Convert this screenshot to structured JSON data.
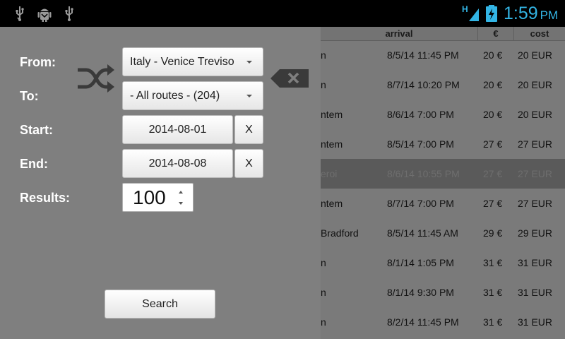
{
  "status_bar": {
    "icons": [
      "usb-icon",
      "android-debug-icon",
      "usb-icon",
      "signal-hspa-icon",
      "battery-charging-icon"
    ],
    "network_type": "H",
    "time": "1:59",
    "ampm": "PM",
    "accent_color": "#33b5e5"
  },
  "filters": {
    "from_label": "From:",
    "from_value": "Italy - Venice Treviso",
    "to_label": "To:",
    "to_value": "- All routes - (204)",
    "start_label": "Start:",
    "start_value": "2014-08-01",
    "end_label": "End:",
    "end_value": "2014-08-08",
    "clear_label": "X",
    "results_label": "Results:",
    "results_value": "100",
    "search_label": "Search",
    "swap_icon": "shuffle-icon",
    "clear_icon": "backspace-clear-icon"
  },
  "table": {
    "headers": [
      "arrival",
      "€",
      "cost"
    ],
    "rows": [
      {
        "name": "n",
        "arrival": "8/5/14 11:45 PM",
        "eur": "20 €",
        "cost": "20 EUR"
      },
      {
        "name": "n",
        "arrival": "8/7/14 10:20 PM",
        "eur": "20 €",
        "cost": "20 EUR"
      },
      {
        "name": "ntem",
        "arrival": "8/6/14 7:00 PM",
        "eur": "20 €",
        "cost": "20 EUR"
      },
      {
        "name": "ntem",
        "arrival": "8/5/14 7:00 PM",
        "eur": "27 €",
        "cost": "27 EUR"
      },
      {
        "name": "eroi",
        "arrival": "8/6/14 10:55 PM",
        "eur": "27 €",
        "cost": "27 EUR",
        "selected": true
      },
      {
        "name": "ntem",
        "arrival": "8/7/14 7:00 PM",
        "eur": "27 €",
        "cost": "27 EUR"
      },
      {
        "name": "Bradford",
        "arrival": "8/5/14 11:45 AM",
        "eur": "29 €",
        "cost": "29 EUR"
      },
      {
        "name": "n",
        "arrival": "8/1/14 1:05 PM",
        "eur": "31 €",
        "cost": "31 EUR"
      },
      {
        "name": "n",
        "arrival": "8/1/14 9:30 PM",
        "eur": "31 €",
        "cost": "31 EUR"
      },
      {
        "name": "n",
        "arrival": "8/2/14 11:45 PM",
        "eur": "31 €",
        "cost": "31 EUR"
      }
    ]
  }
}
